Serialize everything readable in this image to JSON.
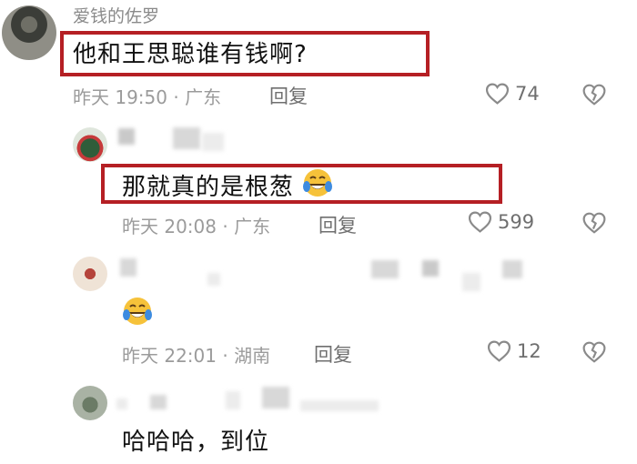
{
  "comments": [
    {
      "username": "爱钱的佐罗",
      "text": "他和王思聪谁有钱啊?",
      "meta": "昨天 19:50 · 广东",
      "reply_label": "回复",
      "likes": "74"
    },
    {
      "text": "那就真的是根葱",
      "meta": "昨天 20:08 · 广东",
      "reply_label": "回复",
      "likes": "599"
    },
    {
      "meta": "昨天 22:01 · 湖南",
      "reply_label": "回复",
      "likes": "12"
    },
    {
      "text": "哈哈哈，到位"
    }
  ],
  "colors": {
    "highlight_box": "#b51f24",
    "meta_text": "#9b9b9b",
    "emoji_face": "#f6c23a",
    "emoji_tears": "#3d8be0"
  },
  "icons": [
    "heart-icon",
    "dislike-heart-icon",
    "laughing-tears-emoji"
  ]
}
